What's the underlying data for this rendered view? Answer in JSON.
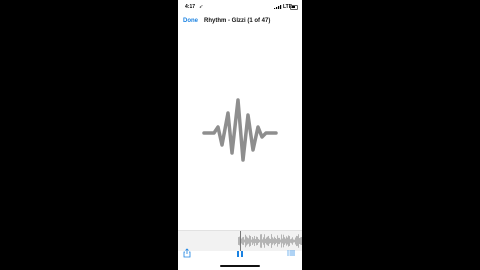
{
  "status_bar": {
    "time": "4:17",
    "location_symbol": "➶",
    "network": "LTE",
    "battery_level": 0.6
  },
  "nav": {
    "done_label": "Done",
    "title": "Rhythm - Glzzi (1 of 47)"
  },
  "artwork": {
    "icon": "sound-wave-icon",
    "color": "#8e8e8e"
  },
  "player": {
    "playhead_position": 0.5,
    "state": "playing"
  },
  "toolbar": {
    "share_icon": "share-icon",
    "pause_icon": "pause-icon",
    "list_icon": "list-icon"
  },
  "colors": {
    "accent": "#1a82e2",
    "background": "#000000"
  }
}
